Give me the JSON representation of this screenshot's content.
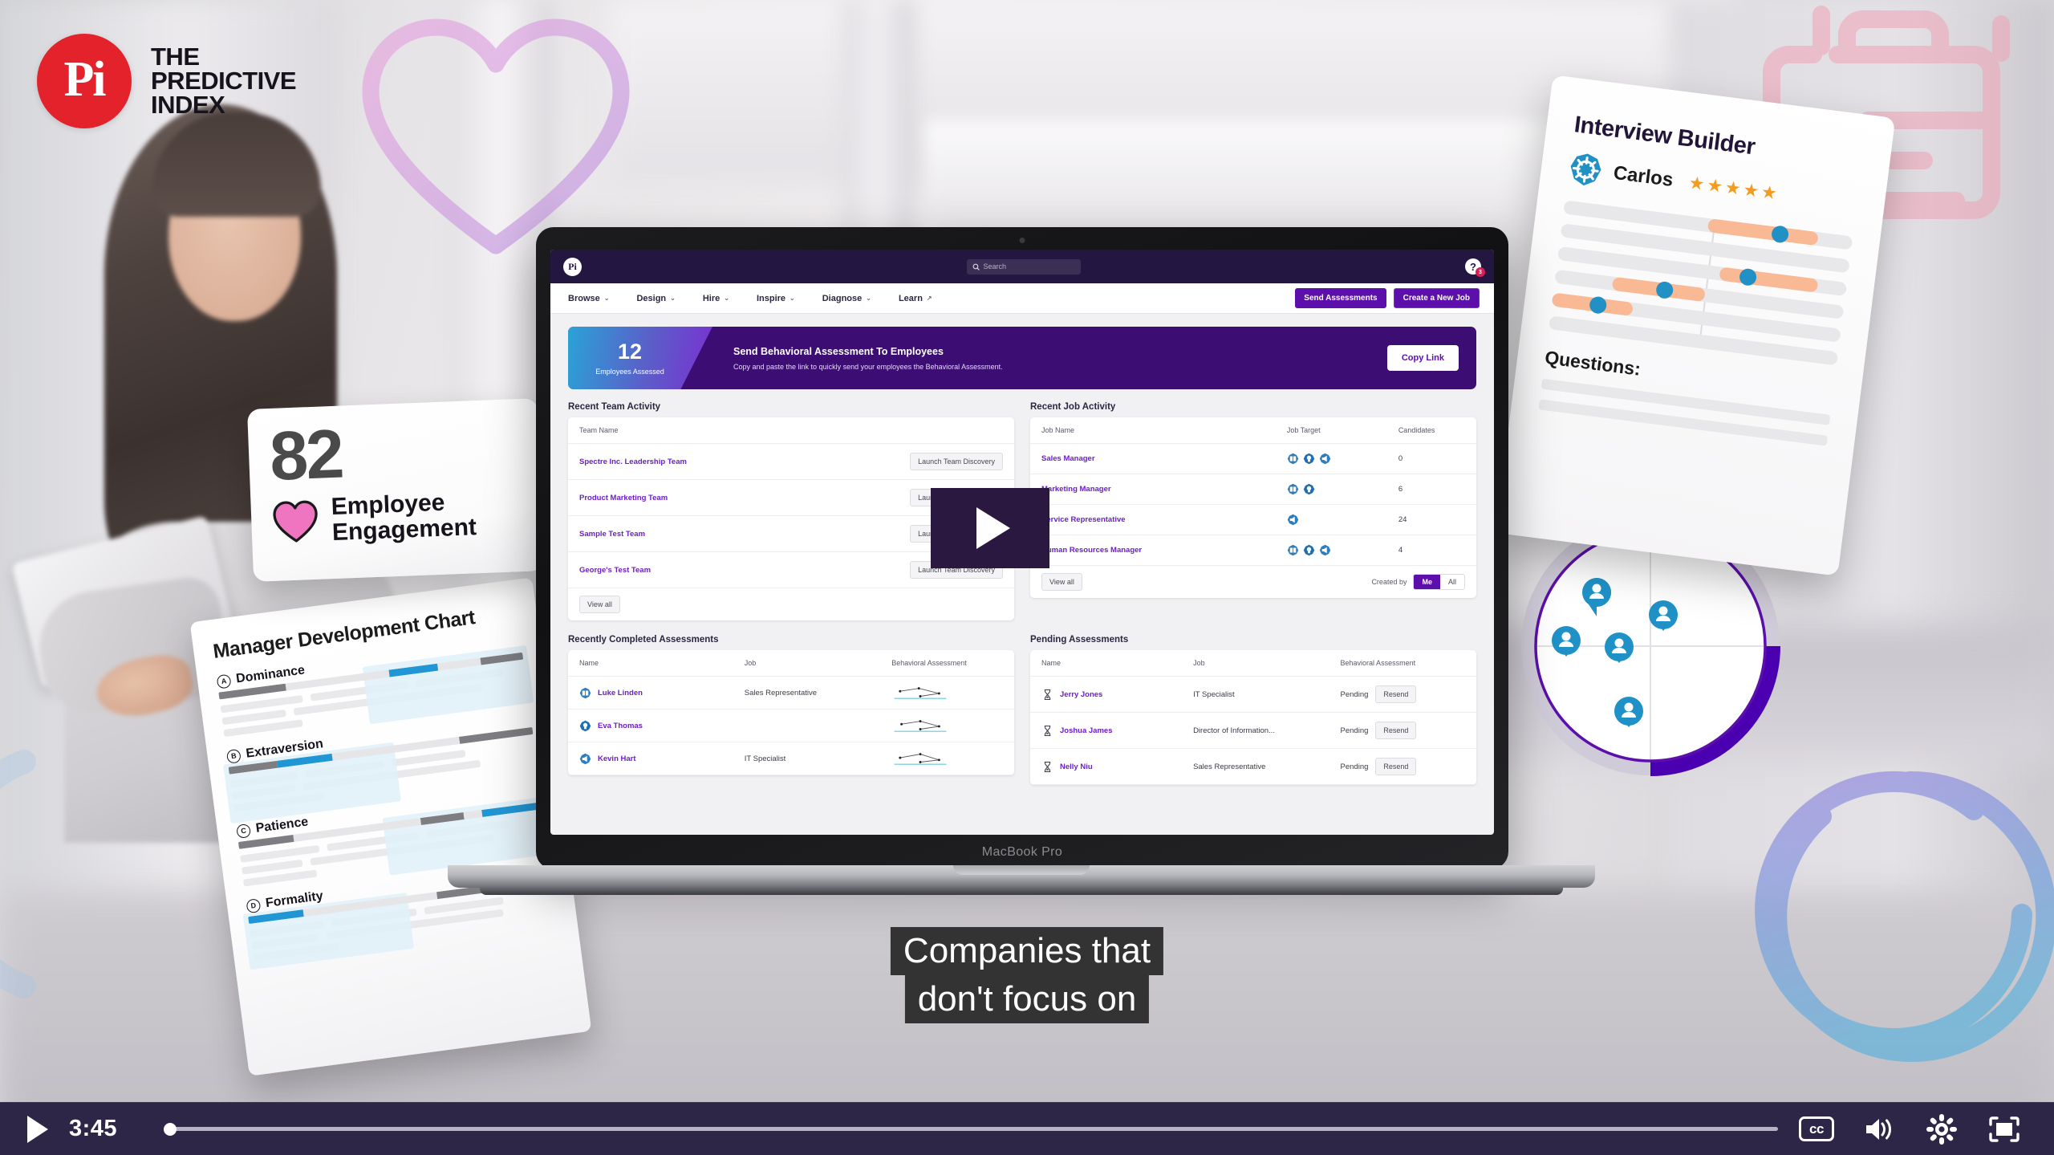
{
  "brand": {
    "badge_text": "Pi",
    "name_line1": "THE",
    "name_line2": "PREDICTIVE",
    "name_line3": "INDEX",
    "red": "#e3222c",
    "purple": "#5c0fab"
  },
  "engagement_card": {
    "score": "82",
    "label": "Employee Engagement",
    "icon": "heart-icon"
  },
  "manager_chart": {
    "title": "Manager Development Chart",
    "factors": [
      {
        "letter": "A",
        "name": "Dominance"
      },
      {
        "letter": "B",
        "name": "Extraversion"
      },
      {
        "letter": "C",
        "name": "Patience"
      },
      {
        "letter": "D",
        "name": "Formality"
      }
    ]
  },
  "interview_builder": {
    "title": "Interview Builder",
    "person": "Carlos",
    "stars": "★★★★★",
    "questions_label": "Questions:"
  },
  "laptop": {
    "model_label": "MacBook Pro"
  },
  "app": {
    "topbar": {
      "logo": "Pi",
      "search_placeholder": "Search",
      "search_icon": "search-icon",
      "help_icon": "question-mark-icon",
      "help_badge": "3"
    },
    "nav": [
      {
        "label": "Browse",
        "caret": "⌄"
      },
      {
        "label": "Design",
        "caret": "⌄"
      },
      {
        "label": "Hire",
        "caret": "⌄"
      },
      {
        "label": "Inspire",
        "caret": "⌄"
      },
      {
        "label": "Diagnose",
        "caret": "⌄"
      },
      {
        "label": "Learn",
        "caret": "↗"
      }
    ],
    "nav_buttons": {
      "send_assessments": "Send Assessments",
      "create_job": "Create a New Job"
    },
    "banner": {
      "count": "12",
      "count_label": "Employees Assessed",
      "title": "Send Behavioral Assessment To Employees",
      "description": "Copy and paste the link to quickly send your employees the Behavioral Assessment.",
      "button": "Copy Link"
    },
    "recent_team_activity": {
      "title": "Recent Team Activity",
      "columns": [
        "Team Name",
        ""
      ],
      "rows": [
        {
          "team": "Spectre Inc. Leadership Team",
          "action": "Launch Team Discovery"
        },
        {
          "team": "Product Marketing Team",
          "action": "Launch Team Discovery"
        },
        {
          "team": "Sample Test Team",
          "action": "Launch Team Discovery"
        },
        {
          "team": "George's Test Team",
          "action": "Launch Team Discovery"
        }
      ],
      "view_all": "View all"
    },
    "recent_job_activity": {
      "title": "Recent Job Activity",
      "columns": [
        "Job Name",
        "Job Target",
        "Candidates"
      ],
      "rows": [
        {
          "job": "Sales Manager",
          "targets": 3,
          "candidates": "0"
        },
        {
          "job": "Marketing Manager",
          "targets": 2,
          "candidates": "6"
        },
        {
          "job": "Service Representative",
          "targets": 1,
          "candidates": "24"
        },
        {
          "job": "Human Resources Manager",
          "targets": 3,
          "candidates": "4"
        }
      ],
      "view_all": "View all",
      "created_by_label": "Created by",
      "filter_options": [
        "Me",
        "All"
      ],
      "filter_selected": "Me"
    },
    "recently_completed": {
      "title": "Recently Completed Assessments",
      "columns": [
        "Name",
        "Job",
        "Behavioral Assessment"
      ],
      "rows": [
        {
          "name": "Luke Linden",
          "job": "Sales Representative"
        },
        {
          "name": "Eva Thomas",
          "job": ""
        },
        {
          "name": "Kevin Hart",
          "job": "IT Specialist"
        }
      ]
    },
    "pending_assessments": {
      "title": "Pending Assessments",
      "columns": [
        "Name",
        "Job",
        "Behavioral Assessment"
      ],
      "rows": [
        {
          "name": "Jerry Jones",
          "job": "IT Specialist",
          "status": "Pending",
          "action": "Resend"
        },
        {
          "name": "Joshua James",
          "job": "Director of Information...",
          "status": "Pending",
          "action": "Resend"
        },
        {
          "name": "Nelly Niu",
          "job": "Sales Representative",
          "status": "Pending",
          "action": "Resend"
        }
      ]
    }
  },
  "caption": {
    "line1": "Companies that",
    "line2": "don't focus on"
  },
  "player": {
    "play_icon": "play-icon",
    "current_time": "3:45",
    "progress_percent": 0.4,
    "captions_label": "cc",
    "volume_icon": "volume-icon",
    "settings_icon": "gear-icon",
    "fullscreen_icon": "fullscreen-icon"
  }
}
